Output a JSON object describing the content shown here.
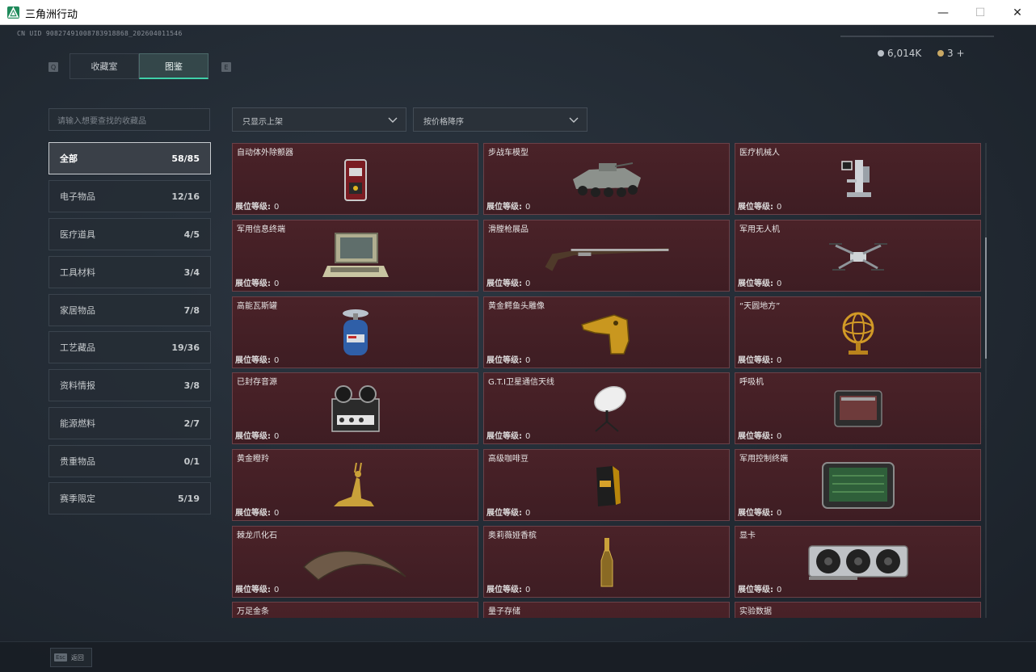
{
  "window": {
    "title": "三角洲行动",
    "minimize": "—",
    "maximize": "☐",
    "close": "✕"
  },
  "header": {
    "uid": "CN UID 90827491008783918868_202604011546",
    "key_left": "Q",
    "key_right": "E",
    "tabs": [
      {
        "label": "收藏室",
        "active": false
      },
      {
        "label": "图鉴",
        "active": true
      }
    ],
    "currency": {
      "silver": "6,014K",
      "gold": "3 +"
    }
  },
  "search": {
    "placeholder": "请输入想要查找的收藏品"
  },
  "filters": {
    "show": "只显示上架",
    "sort": "按价格降序"
  },
  "categories": [
    {
      "label": "全部",
      "count": "58/85",
      "active": true
    },
    {
      "label": "电子物品",
      "count": "12/16"
    },
    {
      "label": "医疗道具",
      "count": "4/5"
    },
    {
      "label": "工具材料",
      "count": "3/4"
    },
    {
      "label": "家居物品",
      "count": "7/8"
    },
    {
      "label": "工艺藏品",
      "count": "19/36"
    },
    {
      "label": "资料情报",
      "count": "3/8"
    },
    {
      "label": "能源燃料",
      "count": "2/7"
    },
    {
      "label": "贵重物品",
      "count": "0/1"
    },
    {
      "label": "赛季限定",
      "count": "5/19"
    }
  ],
  "level_label": "展位等级:",
  "items": [
    {
      "name": "自动体外除颤器",
      "level": "0",
      "icon": "defibrillator-icon"
    },
    {
      "name": "步战车模型",
      "level": "0",
      "icon": "ifv-model-icon"
    },
    {
      "name": "医疗机械人",
      "level": "0",
      "icon": "medical-robot-icon"
    },
    {
      "name": "军用信息终端",
      "level": "0",
      "icon": "info-terminal-icon"
    },
    {
      "name": "滑膛枪展品",
      "level": "0",
      "icon": "musket-icon"
    },
    {
      "name": "军用无人机",
      "level": "0",
      "icon": "drone-icon"
    },
    {
      "name": "高能瓦斯罐",
      "level": "0",
      "icon": "gas-tank-icon"
    },
    {
      "name": "黄金鳄鱼头雕像",
      "level": "0",
      "icon": "croc-head-icon"
    },
    {
      "name": "“天圆地方”",
      "level": "0",
      "icon": "armillary-icon"
    },
    {
      "name": "已封存音源",
      "level": "0",
      "icon": "reel-recorder-icon"
    },
    {
      "name": "G.T.I卫星通信天线",
      "level": "0",
      "icon": "satellite-dish-icon"
    },
    {
      "name": "呼吸机",
      "level": "0",
      "icon": "ventilator-icon"
    },
    {
      "name": "黄金瞪羚",
      "level": "0",
      "icon": "gazelle-icon"
    },
    {
      "name": "高级咖啡豆",
      "level": "0",
      "icon": "coffee-bag-icon"
    },
    {
      "name": "军用控制终端",
      "level": "0",
      "icon": "control-terminal-icon"
    },
    {
      "name": "棘龙爪化石",
      "level": "0",
      "icon": "claw-fossil-icon"
    },
    {
      "name": "奥莉薇娅香槟",
      "level": "0",
      "icon": "champagne-icon"
    },
    {
      "name": "显卡",
      "level": "0",
      "icon": "gpu-icon"
    },
    {
      "name": "万足金条",
      "level": "",
      "icon": "gold-bar-icon"
    },
    {
      "name": "量子存储",
      "level": "",
      "icon": "quantum-storage-icon"
    },
    {
      "name": "实验数据",
      "level": "",
      "icon": "experiment-data-icon"
    }
  ],
  "footer": {
    "esc_key": "Esc",
    "back": "返回"
  }
}
